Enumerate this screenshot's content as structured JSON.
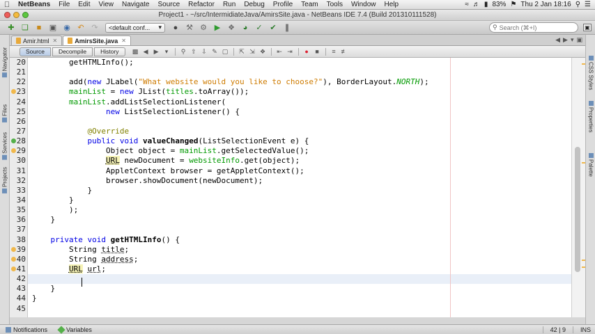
{
  "menubar": {
    "app": "NetBeans",
    "items": [
      "File",
      "Edit",
      "View",
      "Navigate",
      "Source",
      "Refactor",
      "Run",
      "Debug",
      "Profile",
      "Team",
      "Tools",
      "Window",
      "Help"
    ],
    "battery": "83%",
    "clock": "Thu 2 Jan  18:16"
  },
  "window": {
    "title": "Project1 - ~/src/IntermidiateJava/AmirsSite.java - NetBeans IDE 7.4 (Build 201310111528)"
  },
  "toolbar": {
    "config": "<default conf...",
    "search_placeholder": "Search (⌘+I)"
  },
  "left_panels": [
    "Navigator",
    "Files",
    "Services",
    "Projects"
  ],
  "right_panels": [
    "CSS Styles",
    "Properties",
    "Palette"
  ],
  "tabs": [
    {
      "label": "Amir.html",
      "active": false
    },
    {
      "label": "AmirsSite.java",
      "active": true
    }
  ],
  "editor_toolbar": {
    "source": "Source",
    "decompile": "Decompile",
    "history": "History"
  },
  "code": {
    "line_numbers": [
      "20",
      "21",
      "22",
      "23",
      "24",
      "25",
      "26",
      "27",
      "28",
      "29",
      "30",
      "31",
      "32",
      "33",
      "34",
      "35",
      "36",
      "37",
      "38",
      "39",
      "40",
      "41",
      "42",
      "43",
      "44",
      "45"
    ],
    "current_line": "42"
  },
  "statusbar": {
    "notifications": "Notifications",
    "variables": "Variables",
    "position": "42 | 9",
    "mode": "INS"
  },
  "colors": {
    "keyword": "#0000e6",
    "string": "#ce7b00",
    "field": "#009900",
    "annotation": "#808000"
  }
}
